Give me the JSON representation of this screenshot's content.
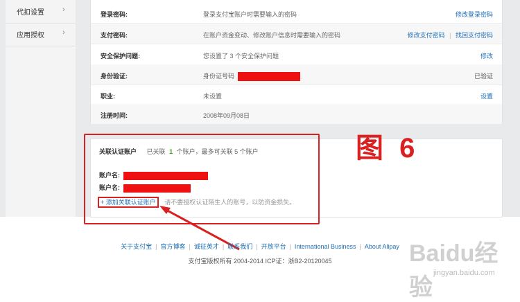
{
  "sidebar": {
    "items": [
      {
        "label": "代扣设置",
        "chevron": "›"
      },
      {
        "label": "应用授权",
        "chevron": "›"
      }
    ]
  },
  "info": {
    "rows": [
      {
        "key": "登录密码:",
        "value": "登录支付宝账户时需要输入的密码",
        "actions": [
          "修改登录密码"
        ]
      },
      {
        "key": "支付密码:",
        "value": "在账户资金变动、修改账户信息时需要输入的密码",
        "actions": [
          "修改支付密码",
          "找回支付密码"
        ]
      },
      {
        "key": "安全保护问题:",
        "value": "您设置了 3 个安全保护问题",
        "actions": [
          "修改"
        ]
      },
      {
        "key": "身份验证:",
        "value": "身份证号码",
        "status": "已验证"
      },
      {
        "key": "职业:",
        "value": "未设置",
        "actions": [
          "设置"
        ]
      },
      {
        "key": "注册时间:",
        "value": "2008年09月08日"
      }
    ]
  },
  "assoc": {
    "title": "关联认证账户",
    "summary_prefix": "已关联",
    "count": "1",
    "summary_suffix": "个账户，最多可关联 5 个账户",
    "account_label_1": "账户名:",
    "account_label_2": "账户名:",
    "add_link": "+ 添加关联认证账户",
    "hint": "请不要授权认证陌生人的账号，以防资金损失。"
  },
  "annotation": {
    "figure_label": "图 6"
  },
  "footer": {
    "links": [
      "关于支付宝",
      "官方博客",
      "诚征英才",
      "联系我们",
      "开放平台",
      "International Business",
      "About Alipay"
    ],
    "copyright": "支付宝版权所有 2004-2014 ICP证：浙B2-20120045"
  },
  "watermark": {
    "logo": "Baidu经验",
    "url": "jingyan.baidu.com"
  },
  "colors": {
    "accent": "#1f6fb5",
    "annotation": "#d92121",
    "redaction": "#ee1111",
    "count": "#3a9a1f"
  }
}
